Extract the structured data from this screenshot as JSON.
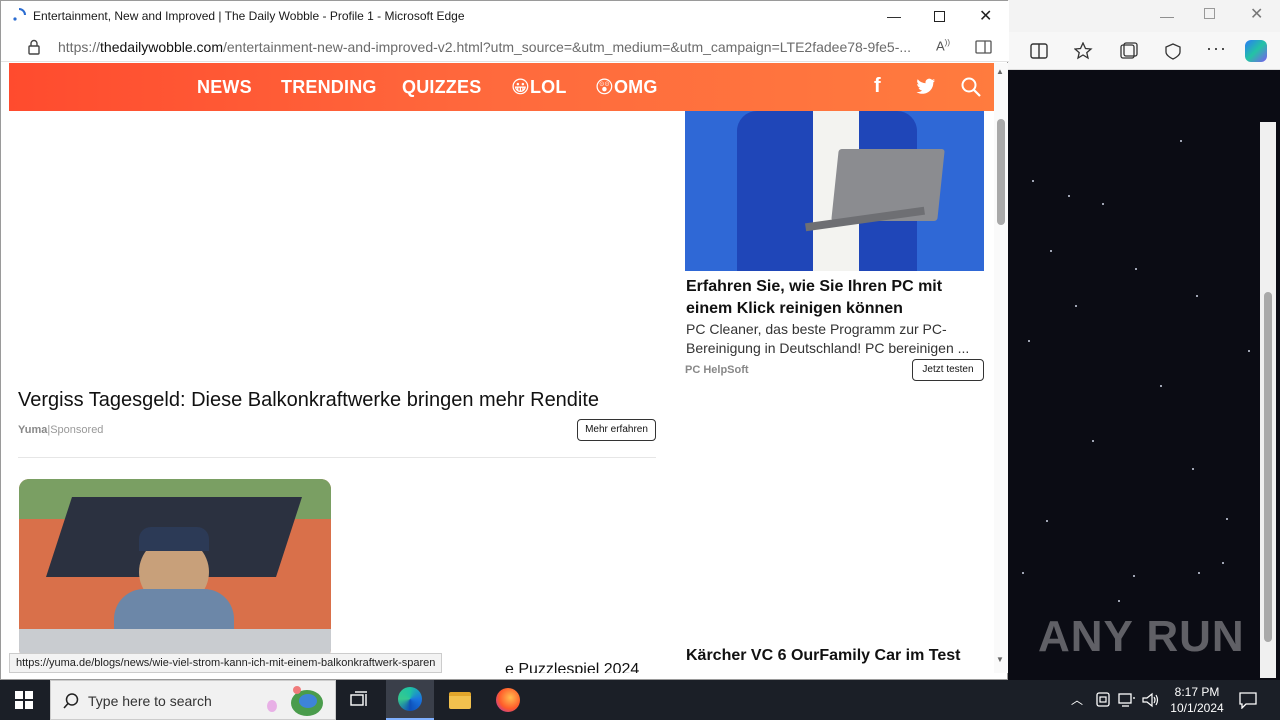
{
  "window": {
    "title": "Entertainment, New and Improved | The Daily Wobble - Profile 1 - Microsoft Edge",
    "url_scheme": "https://",
    "url_host": "thedailywobble.com",
    "url_path": "/entertainment-new-and-improved-v2.html?utm_source=&utm_medium=&utm_campaign=LTE2fadee78-9fe5-..."
  },
  "nav": {
    "items": [
      "NEWS",
      "TRENDING",
      "QUIZZES",
      "😀LOL",
      "😲OMG"
    ],
    "social": [
      "facebook-icon",
      "twitter-icon",
      "search-icon"
    ]
  },
  "ads": {
    "left_main": {
      "title": "Vergiss Tagesgeld: Diese Balkonkraftwerke bringen mehr Rendite",
      "source": "Yuma",
      "separator": "|",
      "sponsored": "Sponsored",
      "button": "Mehr erfahren"
    },
    "right_main": {
      "title_line1": "Erfahren Sie, wie Sie Ihren PC mit",
      "title_line2": "einem Klick reinigen können",
      "desc_line1": "PC Cleaner, das beste Programm zur PC-",
      "desc_line2": "Bereinigung in Deutschland! PC bereinigen ...",
      "source": "PC HelpSoft",
      "button": "Jetzt testen"
    },
    "right_second": {
      "title": "Kärcher VC 6 OurFamily Car im Test"
    },
    "left_second": {
      "title_partial": "e Puzzlespiel 2024"
    }
  },
  "status_bar": {
    "link": "https://yuma.de/blogs/news/wie-viel-strom-kann-ich-mit-einem-balkonkraftwerk-sparen"
  },
  "taskbar": {
    "search_placeholder": "Type here to search",
    "time": "8:17 PM",
    "date": "10/1/2024"
  },
  "watermark": "ANY RUN",
  "colors": {
    "nav_gradient_start": "#ff4b2e",
    "nav_gradient_end": "#ff7b3e",
    "taskbar": "#1b1f27"
  }
}
